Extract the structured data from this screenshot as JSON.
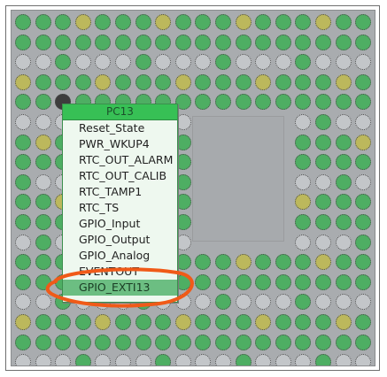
{
  "pin_menu": {
    "title": "PC13",
    "items": [
      {
        "label": "Reset_State",
        "selected": false
      },
      {
        "label": "PWR_WKUP4",
        "selected": false
      },
      {
        "label": "RTC_OUT_ALARM",
        "selected": false
      },
      {
        "label": "RTC_OUT_CALIB",
        "selected": false
      },
      {
        "label": "RTC_TAMP1",
        "selected": false
      },
      {
        "label": "RTC_TS",
        "selected": false
      },
      {
        "label": "GPIO_Input",
        "selected": false
      },
      {
        "label": "GPIO_Output",
        "selected": false
      },
      {
        "label": "GPIO_Analog",
        "selected": false
      },
      {
        "label": "EVENTOUT",
        "selected": false
      },
      {
        "label": "GPIO_EXTI13",
        "selected": true
      }
    ]
  },
  "colors": {
    "pin_assigned": "#4eae63",
    "pin_power": "#c3c6c9",
    "pin_special": "#bcb85c",
    "annotation": "#f05a18",
    "menu_header": "#37c055",
    "selected_item": "#6cbe82"
  }
}
